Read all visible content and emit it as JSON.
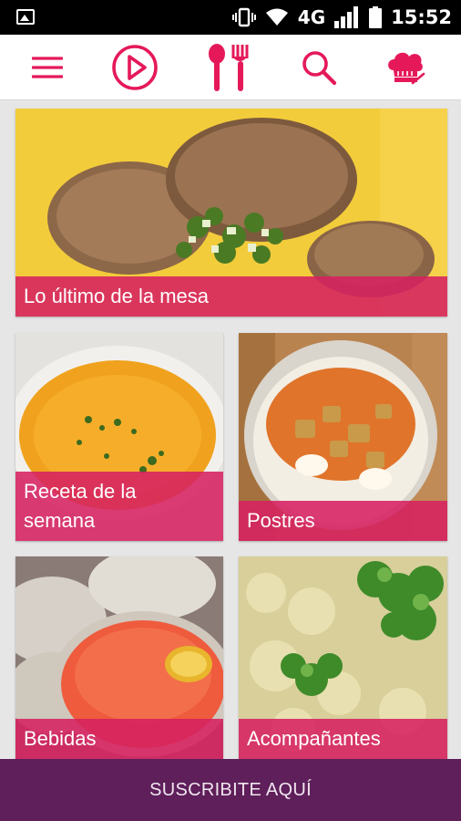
{
  "status_bar": {
    "network": "4G",
    "time": "15:52",
    "icons": [
      "gallery-icon",
      "vibrate-icon",
      "wifi-icon",
      "signal-icon",
      "battery-icon"
    ]
  },
  "toolbar": {
    "accent_color": "#e5195a",
    "items": [
      "menu-icon",
      "play-icon",
      "utensils-icon",
      "search-icon",
      "chef-hat-icon"
    ]
  },
  "cards": {
    "hero": {
      "label": "Lo último de la mesa"
    },
    "recipe": {
      "label_line1": "Receta de la",
      "label_line2": "semana"
    },
    "desserts": {
      "label": "Postres"
    },
    "drinks": {
      "label": "Bebidas"
    },
    "sides": {
      "label": "Acompañantes"
    }
  },
  "footer": {
    "subscribe_label": "SUSCRIBITE AQUÍ",
    "background_color": "#5e1f5a"
  }
}
